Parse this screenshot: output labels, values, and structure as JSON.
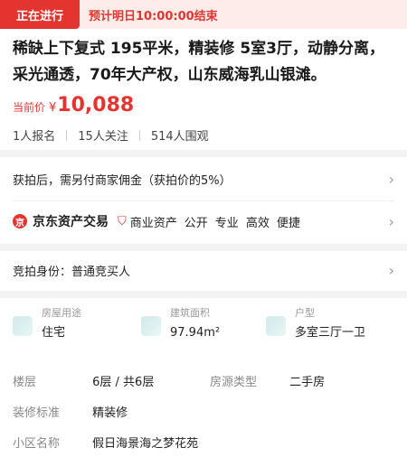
{
  "status": {
    "badge": "正在进行",
    "end_notice": "预计明日10:00:00结束"
  },
  "title": "稀缺上下复式 195平米，精装修 5室3厅，动静分离，采光通透，70年大产权，山东威海乳山银滩。",
  "price": {
    "label": "当前价",
    "currency": "¥",
    "value": "10,088"
  },
  "stats": {
    "signups": "1人报名",
    "followers": "15人关注",
    "viewers": "514人围观"
  },
  "commission_row": {
    "text": "获拍后，需另付商家佣金（获拍价的5%）"
  },
  "platform_row": {
    "name": "京东资产交易",
    "category": "商业资产",
    "tags": [
      "公开",
      "专业",
      "高效",
      "便捷"
    ]
  },
  "bid_identity_row": {
    "label": "竞拍身份：",
    "value": "普通竞买人"
  },
  "attributes": [
    {
      "key": "房屋用途",
      "value": "住宅",
      "icon": "building-icon"
    },
    {
      "key": "建筑面积",
      "value": "97.94m²",
      "icon": "area-icon"
    },
    {
      "key": "户型",
      "value": "多室三厅一卫",
      "icon": "floorplan-icon"
    }
  ],
  "details": {
    "floor": {
      "key": "楼层",
      "value": "6层 / 共6层"
    },
    "source_type": {
      "key": "房源类型",
      "value": "二手房"
    },
    "decoration": {
      "key": "装修标准",
      "value": "精装修"
    },
    "community": {
      "key": "小区名称",
      "value": "假日海景海之梦花苑"
    }
  },
  "colors": {
    "accent": "#e3342f",
    "accent_light": "#fdecea"
  }
}
